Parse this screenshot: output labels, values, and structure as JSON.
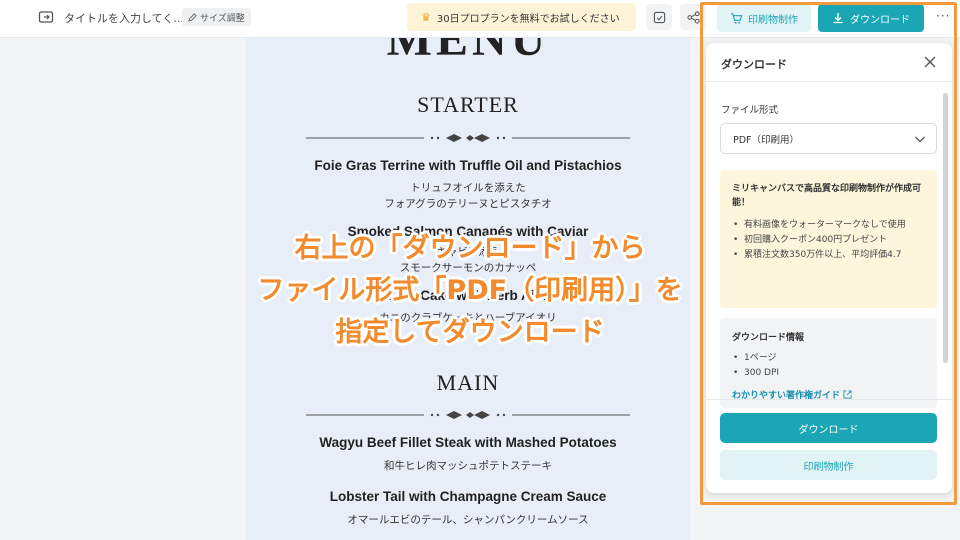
{
  "topbar": {
    "doc_title": "タイトルを入力してく...",
    "size_button": "サイズ調整",
    "promo": "30日プロプランを無料でお試しください",
    "print_button": "印刷物制作",
    "download_button": "ダウンロード",
    "more": "···"
  },
  "canvas": {
    "menu_title": "MENU",
    "starter": {
      "heading": "STARTER",
      "items": [
        {
          "en": "Foie Gras Terrine with Truffle Oil and Pistachios",
          "jp1": "トリュフオイルを添えた",
          "jp2": "フォアグラのテリーヌとピスタチオ"
        },
        {
          "en": "Smoked Salmon Canapés with Caviar",
          "jp1": "キャビア添え",
          "jp2": "スモークサーモンのカナッペ"
        },
        {
          "en": "Crab Cake with Herb Aioli",
          "jp1": "カニのクラブケーキとハーブアイオリ"
        }
      ]
    },
    "main": {
      "heading": "MAIN",
      "items": [
        {
          "en": "Wagyu Beef Fillet Steak with Mashed Potatoes",
          "jp1": "和牛ヒレ肉マッシュポテトステーキ"
        },
        {
          "en": "Lobster Tail with Champagne Cream Sauce",
          "jp1": "オマールエビのテール、シャンパンクリームソース"
        }
      ]
    }
  },
  "overlay": {
    "line1": "右上の「ダウンロード」から",
    "line2": "ファイル形式「PDF（印刷用）」を",
    "line3": "指定してダウンロード"
  },
  "panel": {
    "title": "ダウンロード",
    "format_label": "ファイル形式",
    "format_value": "PDF（印刷用）",
    "promo_heading": "ミリキャンバスで高品質な印刷物制作が作成可能！",
    "promo_items": [
      "有料画像をウォーターマークなしで使用",
      "初回購入クーポン400円プレゼント",
      "累積注文数350万件以上、平均評価4.7"
    ],
    "info_heading": "ダウンロード情報",
    "info_items": [
      "1ページ",
      "300 DPI"
    ],
    "guide_link": "わかりやすい著作権ガイド",
    "download_button": "ダウンロード",
    "print_button": "印刷物制作"
  },
  "colors": {
    "accent": "#1aa6b5",
    "highlight": "#f39a3d",
    "overlay_text": "#f28a2e",
    "canvas_bg": "#e7eef8"
  }
}
